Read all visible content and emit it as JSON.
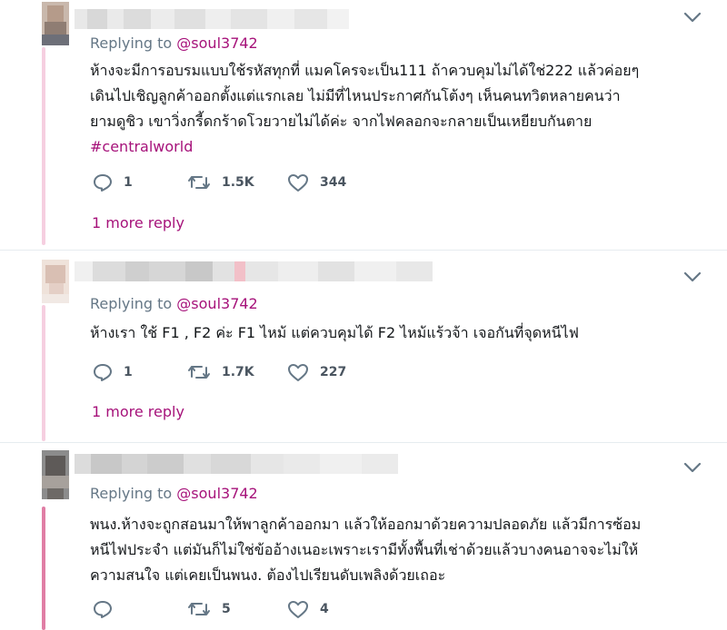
{
  "accent": "#a6127a",
  "thread_line_color": "#f6cfe0",
  "tweets": [
    {
      "replying_prefix": "Replying to ",
      "replying_handle": "@soul3742",
      "body_lines": [
        "ห้างจะมีการอบรมแบบใช้รหัสทุกที่ แมคโครจะเป็น111 ถ้าควบคุมไม่ได้ใช่222 แล้วค่อยๆ",
        "เดินไปเชิญลูกค้าออกตั้งแต่แรกเลย ไม่มีที่ไหนประกาศกันโต้งๆ เห็นคนทวิตหลายคนว่า",
        "ยามดูชิว เขาวิ่งกรี้ดกร้าดโวยวายไม่ได้ค่ะ จากไฟคลอกจะกลายเป็นเหยียบกันตาย"
      ],
      "hashtag": "#centralworld",
      "reply_count": "1",
      "retweet_count": "1.5K",
      "like_count": "344",
      "more_replies": "1 more reply"
    },
    {
      "replying_prefix": "Replying to ",
      "replying_handle": "@soul3742",
      "body_lines": [
        "ห้างเรา ใช้ F1 , F2 ค่ะ F1 ไหม้ แต่ควบคุมได้ F2 ไหม้แร้วจ้า เจอกันที่จุดหนีไฟ"
      ],
      "reply_count": "1",
      "retweet_count": "1.7K",
      "like_count": "227",
      "more_replies": "1 more reply"
    },
    {
      "replying_prefix": "Replying to ",
      "replying_handle": "@soul3742",
      "body_lines": [
        "พนง.ห้างจะถูกสอนมาให้พาลูกค้าออกมา แล้วให้ออกมาด้วยความปลอดภัย แล้วมีการซ้อม",
        "หนีไฟประจำ แต่มันก็ไม่ใช่ข้ออ้างเนอะเพราะเรามีทั้งพื้นที่เช่าด้วยแล้วบางคนอาจจะไม่ให้",
        "ความสนใจ แต่เคยเป็นพนง. ต้องไปเรียนดับเพลิงด้วยเถอะ"
      ],
      "reply_count": "",
      "retweet_count": "5",
      "like_count": "4"
    }
  ],
  "icons": {
    "reply": "reply-icon",
    "retweet": "retweet-icon",
    "like": "heart-icon",
    "menu": "chevron-down-icon"
  }
}
